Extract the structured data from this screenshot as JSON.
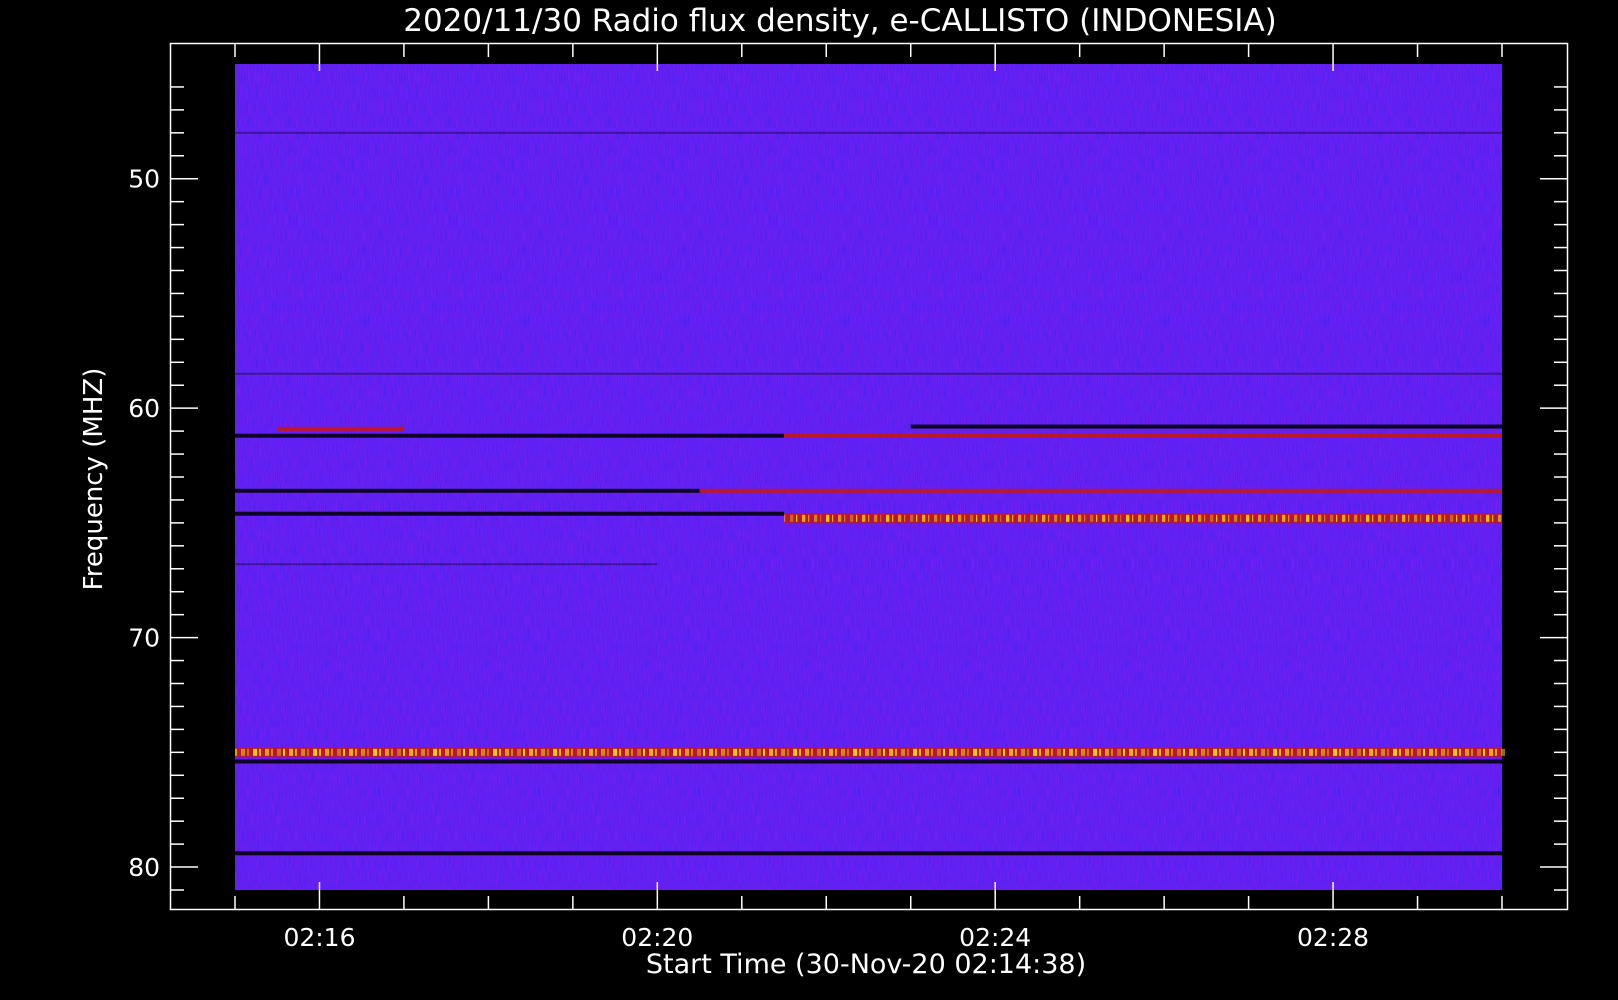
{
  "chart_data": {
    "type": "heatmap",
    "title": "2020/11/30  Radio flux density, e-CALLISTO (INDONESIA)",
    "xlabel": "Start Time (30-Nov-20 02:14:38)",
    "ylabel": "Frequency (MHZ)",
    "x_range": [
      "02:15:00",
      "02:30:00"
    ],
    "y_range": [
      45,
      81
    ],
    "y_reversed": true,
    "x_ticks": [
      "02:16",
      "02:20",
      "02:24",
      "02:28"
    ],
    "y_ticks": [
      50,
      60,
      70,
      80
    ],
    "colormap": {
      "background": "#1f18e0",
      "low": "#000000",
      "mid": "#c01818",
      "high": "#ffe000"
    },
    "bands": [
      {
        "freq": 48.0,
        "start": "02:15:00",
        "end": "02:30:00",
        "level": "faint-dark"
      },
      {
        "freq": 58.5,
        "start": "02:15:00",
        "end": "02:30:00",
        "level": "faint-dark"
      },
      {
        "freq": 60.9,
        "start": "02:15:30",
        "end": "02:17:00",
        "level": "bright"
      },
      {
        "freq": 61.2,
        "start": "02:15:00",
        "end": "02:21:30",
        "level": "dark"
      },
      {
        "freq": 60.8,
        "start": "02:23:00",
        "end": "02:30:00",
        "level": "dark"
      },
      {
        "freq": 61.2,
        "start": "02:21:30",
        "end": "02:30:00",
        "level": "bright"
      },
      {
        "freq": 63.6,
        "start": "02:15:00",
        "end": "02:20:30",
        "level": "dark"
      },
      {
        "freq": 63.6,
        "start": "02:20:30",
        "end": "02:30:00",
        "level": "bright"
      },
      {
        "freq": 64.6,
        "start": "02:15:00",
        "end": "02:21:30",
        "level": "dark"
      },
      {
        "freq": 64.8,
        "start": "02:21:30",
        "end": "02:30:00",
        "level": "peak"
      },
      {
        "freq": 66.8,
        "start": "02:15:00",
        "end": "02:20:00",
        "level": "faint-dark"
      },
      {
        "freq": 75.0,
        "start": "02:15:00",
        "end": "02:30:00",
        "level": "peak"
      },
      {
        "freq": 75.4,
        "start": "02:15:00",
        "end": "02:30:00",
        "level": "dark"
      },
      {
        "freq": 79.4,
        "start": "02:15:00",
        "end": "02:30:00",
        "level": "dark"
      }
    ]
  }
}
